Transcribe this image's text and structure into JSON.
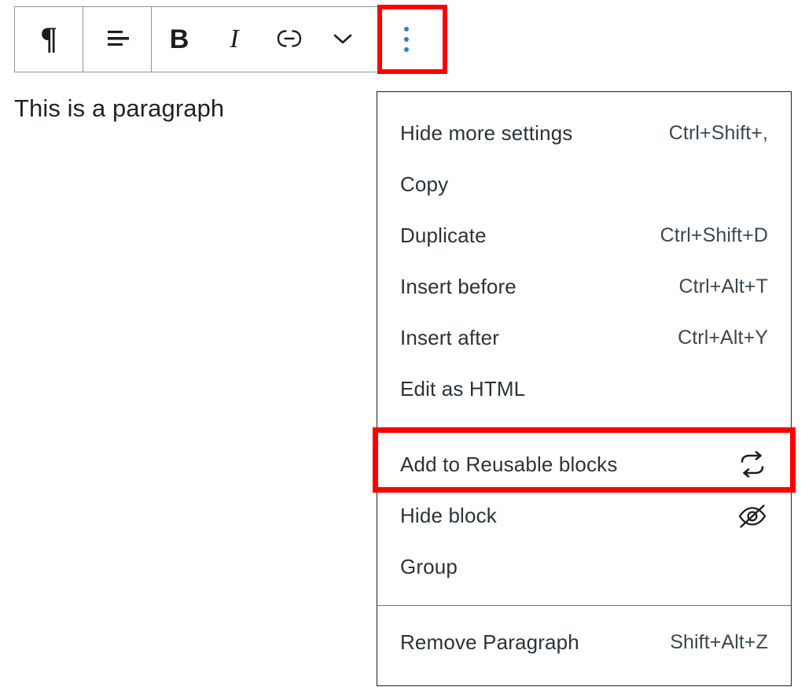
{
  "toolbar": {
    "name": "block-toolbar",
    "groups": [
      {
        "name": "block-type-group",
        "buttons": [
          {
            "name": "paragraph-block-type-button",
            "icon": "pilcrow-icon",
            "glyph": "¶",
            "label": "Paragraph"
          }
        ]
      },
      {
        "name": "alignment-group",
        "buttons": [
          {
            "name": "align-text-button",
            "icon": "align-text-icon",
            "label": "Align text"
          }
        ]
      },
      {
        "name": "formatting-group",
        "buttons": [
          {
            "name": "bold-button",
            "icon": "bold-icon",
            "glyph": "B",
            "label": "Bold"
          },
          {
            "name": "italic-button",
            "icon": "italic-icon",
            "glyph": "I",
            "label": "Italic"
          },
          {
            "name": "link-button",
            "icon": "link-icon",
            "label": "Link"
          },
          {
            "name": "more-rich-text-controls-button",
            "icon": "chevron-down-icon",
            "label": "More rich text controls"
          }
        ]
      }
    ],
    "more_options": {
      "name": "block-options-button",
      "icon": "three-dots-vertical-icon",
      "label": "Options",
      "dot_color": "#2e82c4",
      "highlighted": true
    }
  },
  "content": {
    "paragraph": "This is a paragraph"
  },
  "menu": {
    "name": "block-options-menu",
    "groups": [
      {
        "name": "menu-group-settings",
        "items": [
          {
            "label": "Hide more settings",
            "shortcut": "Ctrl+Shift+,",
            "icon": "",
            "highlighted": false
          },
          {
            "label": "Copy",
            "shortcut": "",
            "icon": "",
            "highlighted": false
          },
          {
            "label": "Duplicate",
            "shortcut": "Ctrl+Shift+D",
            "icon": "",
            "highlighted": false
          },
          {
            "label": "Insert before",
            "shortcut": "Ctrl+Alt+T",
            "icon": "",
            "highlighted": false
          },
          {
            "label": "Insert after",
            "shortcut": "Ctrl+Alt+Y",
            "icon": "",
            "highlighted": false
          },
          {
            "label": "Edit as HTML",
            "shortcut": "",
            "icon": "",
            "highlighted": false
          }
        ]
      },
      {
        "name": "menu-group-block-actions",
        "items": [
          {
            "label": "Add to Reusable blocks",
            "shortcut": "",
            "icon": "reusable-block-icon",
            "highlighted": true
          },
          {
            "label": "Hide block",
            "shortcut": "",
            "icon": "eye-off-icon",
            "highlighted": false
          },
          {
            "label": "Group",
            "shortcut": "",
            "icon": "",
            "highlighted": false
          }
        ]
      },
      {
        "name": "menu-group-remove",
        "items": [
          {
            "label": "Remove Paragraph",
            "shortcut": "Shift+Alt+Z",
            "icon": "",
            "highlighted": false
          }
        ]
      }
    ]
  },
  "annotations": {
    "highlight_color": "#fe0000",
    "highlights": [
      {
        "name": "options-button-highlight",
        "target": "block-options-button"
      },
      {
        "name": "add-to-reusable-blocks-highlight",
        "target": "Add to Reusable blocks"
      }
    ]
  }
}
